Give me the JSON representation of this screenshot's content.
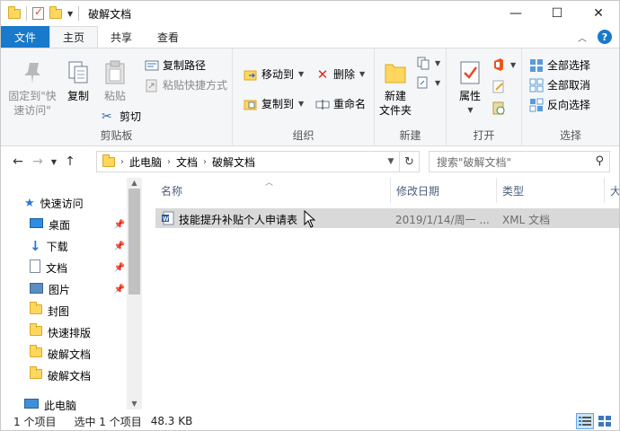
{
  "window": {
    "title": "破解文档",
    "controls": {
      "minimize": "—",
      "maximize": "☐",
      "close": "✕"
    }
  },
  "ribbon_tabs": [
    "文件",
    "主页",
    "共享",
    "查看"
  ],
  "ribbon": {
    "clipboard": {
      "label": "剪贴板",
      "pin_quick_access": "固定到\"快\n速访问\"",
      "copy": "复制",
      "paste": "粘贴",
      "cut": "剪切",
      "copy_path": "复制路径",
      "paste_shortcut": "粘贴快捷方式"
    },
    "organize": {
      "label": "组织",
      "move_to": "移动到",
      "copy_to": "复制到",
      "delete": "删除",
      "rename": "重命名"
    },
    "new": {
      "label": "新建",
      "new_folder": "新建\n文件夹"
    },
    "open": {
      "label": "打开",
      "properties": "属性"
    },
    "select": {
      "label": "选择",
      "select_all": "全部选择",
      "select_none": "全部取消",
      "invert": "反向选择"
    }
  },
  "address": {
    "crumbs": [
      "此电脑",
      "文档",
      "破解文档"
    ],
    "search_placeholder": "搜索\"破解文档\""
  },
  "nav_pane": {
    "items": [
      {
        "label": "快速访问",
        "icon": "star-icon",
        "pinned": false
      },
      {
        "label": "桌面",
        "icon": "desktop-icon",
        "pinned": true
      },
      {
        "label": "下载",
        "icon": "download-icon",
        "pinned": true
      },
      {
        "label": "文档",
        "icon": "document-icon",
        "pinned": true
      },
      {
        "label": "图片",
        "icon": "pictures-icon",
        "pinned": true
      },
      {
        "label": "封图",
        "icon": "folder-icon",
        "pinned": false
      },
      {
        "label": "快速排版",
        "icon": "folder-icon",
        "pinned": false
      },
      {
        "label": "破解文档",
        "icon": "folder-icon",
        "pinned": false
      },
      {
        "label": "破解文档",
        "icon": "folder-icon",
        "pinned": false
      },
      {
        "label": "此电脑",
        "icon": "computer-icon",
        "pinned": false
      }
    ]
  },
  "columns": [
    "名称",
    "修改日期",
    "类型",
    "大"
  ],
  "files": [
    {
      "name": "技能提升补贴个人申请表",
      "modified": "2019/1/14/周一 ...",
      "type": "XML 文档"
    }
  ],
  "status": {
    "count": "1 个项目",
    "selected": "选中 1 个项目",
    "size": "48.3 KB"
  },
  "colors": {
    "accent": "#1979ca",
    "selected_row": "#d9d9d9",
    "ribbon_bg": "#f5f6f7"
  }
}
